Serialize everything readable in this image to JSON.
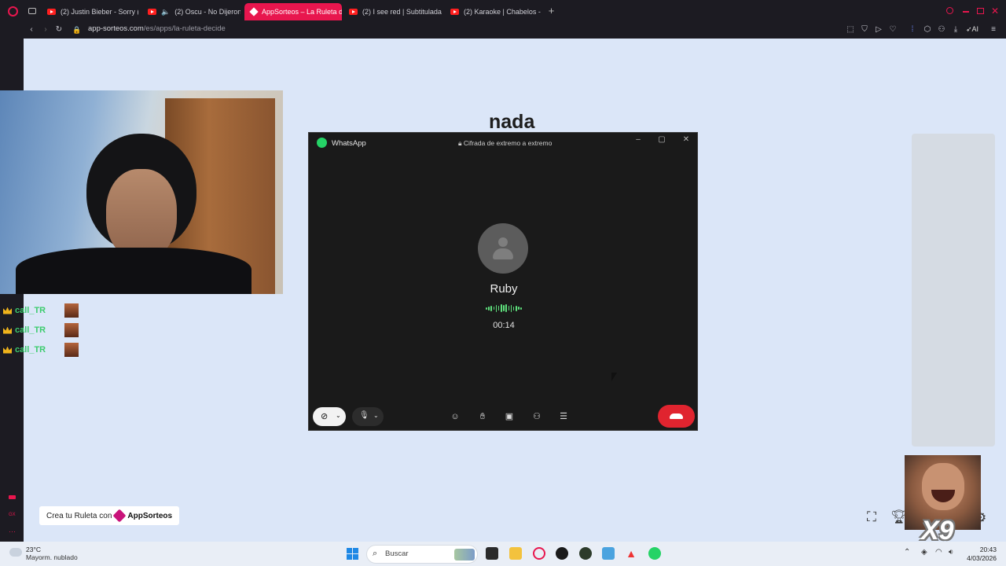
{
  "browser": {
    "tabs": [
      {
        "title": "(2) Justin Bieber - Sorry (l",
        "active": false
      },
      {
        "title": "(2) Oscu - No Dijeron l",
        "active": false
      },
      {
        "title": "AppSorteos – La Ruleta de",
        "active": true
      },
      {
        "title": "(2) I see red | Subtitulada",
        "active": false
      },
      {
        "title": "(2) Karaoke | Chabelos - E",
        "active": false
      }
    ],
    "url_host": "app-sorteos.com",
    "url_path": "/es/apps/la-ruleta-decide",
    "ai_label": "AI"
  },
  "page": {
    "wheel_title": "nada",
    "creator_button": {
      "prefix": "Crea tu Ruleta con",
      "brand": "AppSorteos"
    }
  },
  "chat": {
    "lines": [
      {
        "user": "call_TR"
      },
      {
        "user": "call_TR"
      },
      {
        "user": "call_TR"
      }
    ]
  },
  "whatsapp": {
    "app_title": "WhatsApp",
    "encryption": "Cifrada de extremo a extremo",
    "caller": "Ruby",
    "duration": "00:14"
  },
  "meme": {
    "caption": "X9"
  },
  "taskbar": {
    "weather_temp": "23°C",
    "weather_desc": "Mayorm. nublado",
    "search_placeholder": "Buscar",
    "time": "20:43",
    "date": "4/03/2026"
  },
  "colors": {
    "accent_tab": "#e8164e",
    "whatsapp_green": "#25d366",
    "end_call_red": "#e0242f",
    "page_bg": "#dbe6f8"
  }
}
